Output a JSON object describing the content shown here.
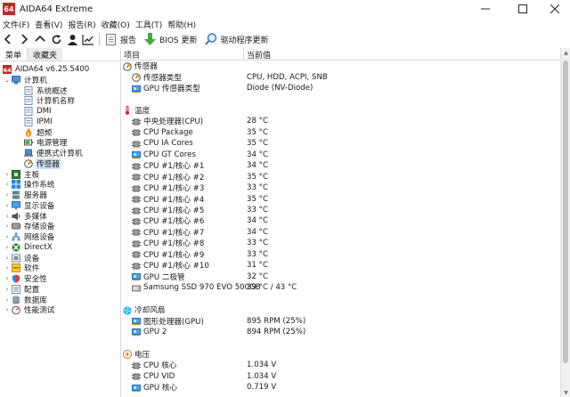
{
  "window": {
    "title": "AIDA64 Extreme",
    "badge": "64"
  },
  "menu": [
    "文件(F)",
    "查看(V)",
    "报告(R)",
    "收藏(O)",
    "工具(T)",
    "帮助(H)"
  ],
  "toolbar": {
    "report": "报告",
    "bios": "BIOS 更新",
    "driver": "驱动程序更新"
  },
  "left_tabs": {
    "menu": "菜单",
    "favorites": "收藏夹"
  },
  "tree": [
    {
      "label": "AIDA64 v6.25.5400",
      "level": 0,
      "chev": "",
      "icon": "aida-icon",
      "sel": false
    },
    {
      "label": "计算机",
      "level": 1,
      "chev": "v",
      "icon": "computer-icon",
      "sel": false
    },
    {
      "label": "系统概述",
      "level": 2,
      "chev": "",
      "icon": "page-icon",
      "sel": false
    },
    {
      "label": "计算机名称",
      "level": 2,
      "chev": "",
      "icon": "page-icon",
      "sel": false
    },
    {
      "label": "DMI",
      "level": 2,
      "chev": "",
      "icon": "page-icon",
      "sel": false
    },
    {
      "label": "IPMI",
      "level": 2,
      "chev": "",
      "icon": "page-icon",
      "sel": false
    },
    {
      "label": "超频",
      "level": 2,
      "chev": "",
      "icon": "fire-icon",
      "sel": false
    },
    {
      "label": "电源管理",
      "level": 2,
      "chev": "",
      "icon": "battery-icon",
      "sel": false
    },
    {
      "label": "便携式计算机",
      "level": 2,
      "chev": "",
      "icon": "laptop-icon",
      "sel": false
    },
    {
      "label": "传感器",
      "level": 2,
      "chev": "",
      "icon": "sensor-icon",
      "sel": true
    },
    {
      "label": "主板",
      "level": 1,
      "chev": ">",
      "icon": "motherboard-icon",
      "sel": false
    },
    {
      "label": "操作系统",
      "level": 1,
      "chev": ">",
      "icon": "windows-icon",
      "sel": false
    },
    {
      "label": "服务器",
      "level": 1,
      "chev": ">",
      "icon": "server-icon",
      "sel": false
    },
    {
      "label": "显示设备",
      "level": 1,
      "chev": ">",
      "icon": "display-icon",
      "sel": false
    },
    {
      "label": "多媒体",
      "level": 1,
      "chev": ">",
      "icon": "speaker-icon",
      "sel": false
    },
    {
      "label": "存储设备",
      "level": 1,
      "chev": ">",
      "icon": "storage-icon",
      "sel": false
    },
    {
      "label": "网络设备",
      "level": 1,
      "chev": ">",
      "icon": "network-icon",
      "sel": false
    },
    {
      "label": "DirectX",
      "level": 1,
      "chev": ">",
      "icon": "directx-icon",
      "sel": false
    },
    {
      "label": "设备",
      "level": 1,
      "chev": ">",
      "icon": "device-icon",
      "sel": false
    },
    {
      "label": "软件",
      "level": 1,
      "chev": ">",
      "icon": "software-icon",
      "sel": false
    },
    {
      "label": "安全性",
      "level": 1,
      "chev": ">",
      "icon": "shield-icon",
      "sel": false
    },
    {
      "label": "配置",
      "level": 1,
      "chev": ">",
      "icon": "config-icon",
      "sel": false
    },
    {
      "label": "数据库",
      "level": 1,
      "chev": ">",
      "icon": "database-icon",
      "sel": false
    },
    {
      "label": "性能测试",
      "level": 1,
      "chev": ">",
      "icon": "benchmark-icon",
      "sel": false
    }
  ],
  "columns": {
    "item": "项目",
    "value": "当前值"
  },
  "rows": [
    {
      "type": "cat",
      "name": "传感器",
      "value": "",
      "icon": "sensor-icon"
    },
    {
      "type": "item",
      "name": "传感器类型",
      "value": "CPU, HDD, ACPI, SNB",
      "icon": "sensor-icon"
    },
    {
      "type": "item",
      "name": "GPU 传感器类型",
      "value": "Diode  (NV-Diode)",
      "icon": "gpu-icon"
    },
    {
      "type": "blank"
    },
    {
      "type": "cat",
      "name": "温度",
      "value": "",
      "icon": "thermometer-icon"
    },
    {
      "type": "item",
      "name": "中央处理器(CPU)",
      "value": "28 °C",
      "icon": "cpu-icon"
    },
    {
      "type": "item",
      "name": "CPU Package",
      "value": "35 °C",
      "icon": "cpu-icon"
    },
    {
      "type": "item",
      "name": "CPU IA Cores",
      "value": "35 °C",
      "icon": "cpu-icon"
    },
    {
      "type": "item",
      "name": "CPU GT Cores",
      "value": "34 °C",
      "icon": "gpu-icon"
    },
    {
      "type": "item",
      "name": "CPU #1/核心 #1",
      "value": "34 °C",
      "icon": "cpu-icon"
    },
    {
      "type": "item",
      "name": "CPU #1/核心 #2",
      "value": "35 °C",
      "icon": "cpu-icon"
    },
    {
      "type": "item",
      "name": "CPU #1/核心 #3",
      "value": "33 °C",
      "icon": "cpu-icon"
    },
    {
      "type": "item",
      "name": "CPU #1/核心 #4",
      "value": "35 °C",
      "icon": "cpu-icon"
    },
    {
      "type": "item",
      "name": "CPU #1/核心 #5",
      "value": "33 °C",
      "icon": "cpu-icon"
    },
    {
      "type": "item",
      "name": "CPU #1/核心 #6",
      "value": "34 °C",
      "icon": "cpu-icon"
    },
    {
      "type": "item",
      "name": "CPU #1/核心 #7",
      "value": "34 °C",
      "icon": "cpu-icon"
    },
    {
      "type": "item",
      "name": "CPU #1/核心 #8",
      "value": "33 °C",
      "icon": "cpu-icon"
    },
    {
      "type": "item",
      "name": "CPU #1/核心 #9",
      "value": "33 °C",
      "icon": "cpu-icon"
    },
    {
      "type": "item",
      "name": "CPU #1/核心 #10",
      "value": "31 °C",
      "icon": "cpu-icon"
    },
    {
      "type": "item",
      "name": "GPU 二极管",
      "value": "32 °C",
      "icon": "gpu-icon"
    },
    {
      "type": "item",
      "name": "Samsung SSD 970 EVO 500GB",
      "value": "39 °C / 43 °C",
      "icon": "disk-icon"
    },
    {
      "type": "blank"
    },
    {
      "type": "cat",
      "name": "冷却风扇",
      "value": "",
      "icon": "fan-icon"
    },
    {
      "type": "item",
      "name": "图形处理器(GPU)",
      "value": "895 RPM  (25%)",
      "icon": "gpu-icon"
    },
    {
      "type": "item",
      "name": "GPU 2",
      "value": "894 RPM  (25%)",
      "icon": "gpu-icon"
    },
    {
      "type": "blank"
    },
    {
      "type": "cat",
      "name": "电压",
      "value": "",
      "icon": "voltage-icon"
    },
    {
      "type": "item",
      "name": "CPU 核心",
      "value": "1.034 V",
      "icon": "cpu-icon"
    },
    {
      "type": "item",
      "name": "CPU VID",
      "value": "1.034 V",
      "icon": "cpu-icon"
    },
    {
      "type": "item",
      "name": "GPU 核心",
      "value": "0.719 V",
      "icon": "gpu-icon"
    }
  ]
}
